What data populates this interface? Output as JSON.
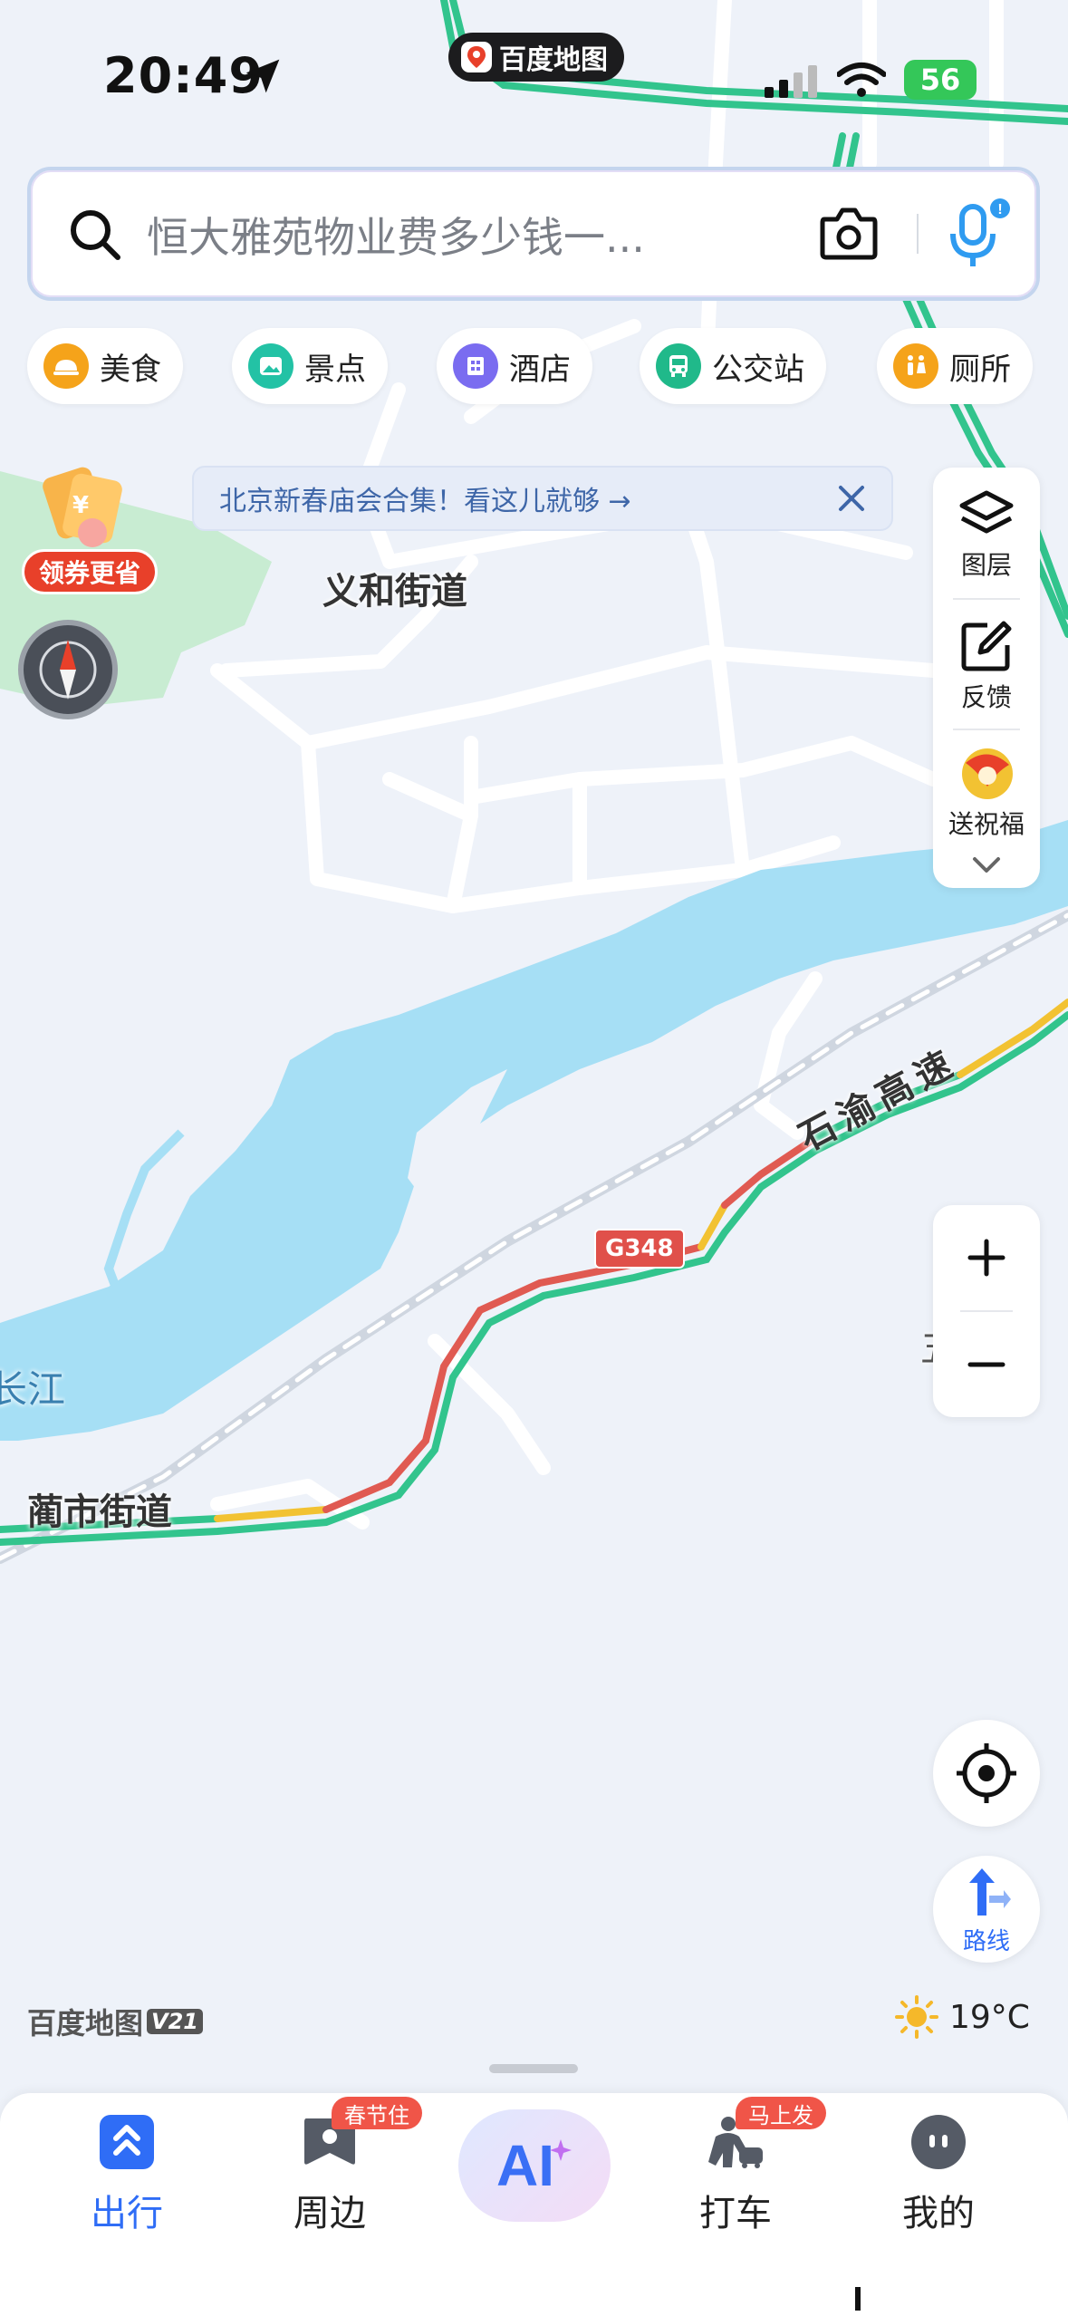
{
  "status_bar": {
    "time": "20:49",
    "battery": "56",
    "app_pill": "百度地图"
  },
  "search": {
    "placeholder": "恒大雅苑物业费多少钱一..."
  },
  "categories": [
    {
      "label": "美食",
      "icon": "food-icon",
      "color": "#f5a31a"
    },
    {
      "label": "景点",
      "icon": "scenic-icon",
      "color": "#23c2a5"
    },
    {
      "label": "酒店",
      "icon": "hotel-icon",
      "color": "#7a6cf0"
    },
    {
      "label": "公交站",
      "icon": "bus-stop-icon",
      "color": "#20b98a"
    },
    {
      "label": "厕所",
      "icon": "toilet-icon",
      "color": "#f5a31a"
    }
  ],
  "banner": {
    "text": "北京新春庙会合集！看这儿就够 →"
  },
  "promo": {
    "coupon_label": "领券更省"
  },
  "tools": {
    "layers": "图层",
    "feedback": "反馈",
    "blessing": "送祝福"
  },
  "map": {
    "labels": {
      "yihe": "义和街道",
      "linshi": "蔺市街道",
      "river": "长江",
      "highway": "石渝高速",
      "road_shield": "G348",
      "edge_partial": "五"
    }
  },
  "route_button": "路线",
  "brand": {
    "name": "百度地图",
    "version": "V21"
  },
  "weather": {
    "temp": "19°C",
    "icon": "sun-icon"
  },
  "nav": {
    "travel": "出行",
    "nearby": "周边",
    "nearby_badge": "春节住",
    "ai": "AI",
    "taxi": "打车",
    "taxi_badge": "马上发",
    "mine": "我的"
  },
  "colors": {
    "accent": "#2f6df6",
    "river": "#a6dff5",
    "road_green": "#32c48d",
    "road_red": "#e05a52",
    "road_yellow": "#f2c232"
  }
}
